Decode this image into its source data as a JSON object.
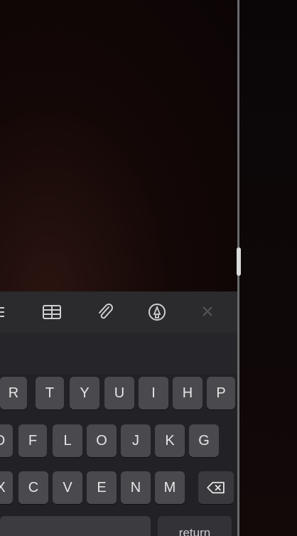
{
  "toolbar": {
    "items": [
      {
        "icon": "list-icon"
      },
      {
        "icon": "table-icon"
      },
      {
        "icon": "attachment-icon"
      },
      {
        "icon": "markup-icon"
      },
      {
        "icon": "close-icon"
      }
    ]
  },
  "keyboard": {
    "row1": [
      "R",
      "T",
      "Y",
      "U",
      "I",
      "H",
      "P"
    ],
    "row2": [
      "D",
      "F",
      "L",
      "O",
      "J",
      "K",
      "G"
    ],
    "row3": [
      "X",
      "C",
      "V",
      "E",
      "N",
      "M"
    ],
    "return_label": "return"
  }
}
